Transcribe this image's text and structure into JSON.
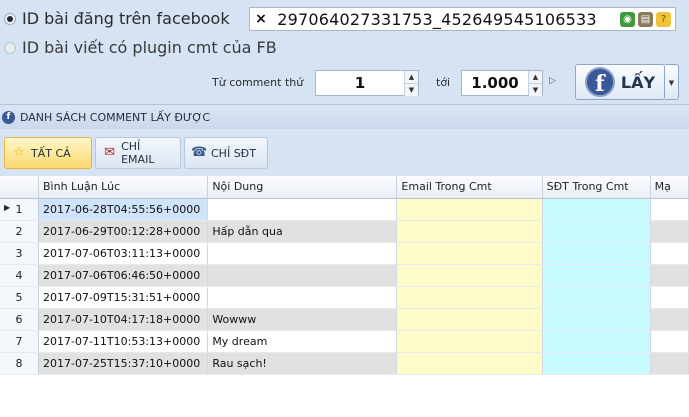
{
  "source": {
    "option_facebook_post": "ID bài đăng trên facebook",
    "option_plugin": "ID bài viết có plugin cmt của FB",
    "id_value": "297064027331753_452649545106533",
    "clear_icon": "×"
  },
  "range": {
    "from_label": "Từ comment thứ",
    "from_value": "1",
    "to_label": "tới",
    "to_value": "1.000"
  },
  "get_button": {
    "logo": "f",
    "label": "LẤY"
  },
  "section": {
    "title": "DANH SÁCH COMMENT LẤY ĐƯỢC"
  },
  "filters": {
    "all": "TẤT CẢ",
    "email_only": "CHỈ EMAIL",
    "phone_only": "CHỈ SĐT"
  },
  "grid": {
    "columns": [
      "Bình Luận Lúc",
      "Nội Dung",
      "Email Trong Cmt",
      "SĐT Trong Cmt",
      "Mạ"
    ],
    "rows": [
      {
        "n": "1",
        "time": "2017-06-28T04:55:56+0000",
        "content": ""
      },
      {
        "n": "2",
        "time": "2017-06-29T00:12:28+0000",
        "content": "Hấp dẫn qua"
      },
      {
        "n": "3",
        "time": "2017-07-06T03:11:13+0000",
        "content": ""
      },
      {
        "n": "4",
        "time": "2017-07-06T06:46:50+0000",
        "content": ""
      },
      {
        "n": "5",
        "time": "2017-07-09T15:31:51+0000",
        "content": ""
      },
      {
        "n": "6",
        "time": "2017-07-10T04:17:18+0000",
        "content": "Wowww"
      },
      {
        "n": "7",
        "time": "2017-07-11T10:53:13+0000",
        "content": "My dream"
      },
      {
        "n": "8",
        "time": "2017-07-25T15:37:10+0000",
        "content": "Rau sạch!"
      }
    ]
  },
  "colors": {
    "background": "#d6e3f3",
    "email_column": "#fdfbc8",
    "phone_column": "#c8fbfd",
    "selected_cell": "#cfe3fb",
    "active_filter": "#fbd96e",
    "facebook_blue": "#3b5998"
  }
}
